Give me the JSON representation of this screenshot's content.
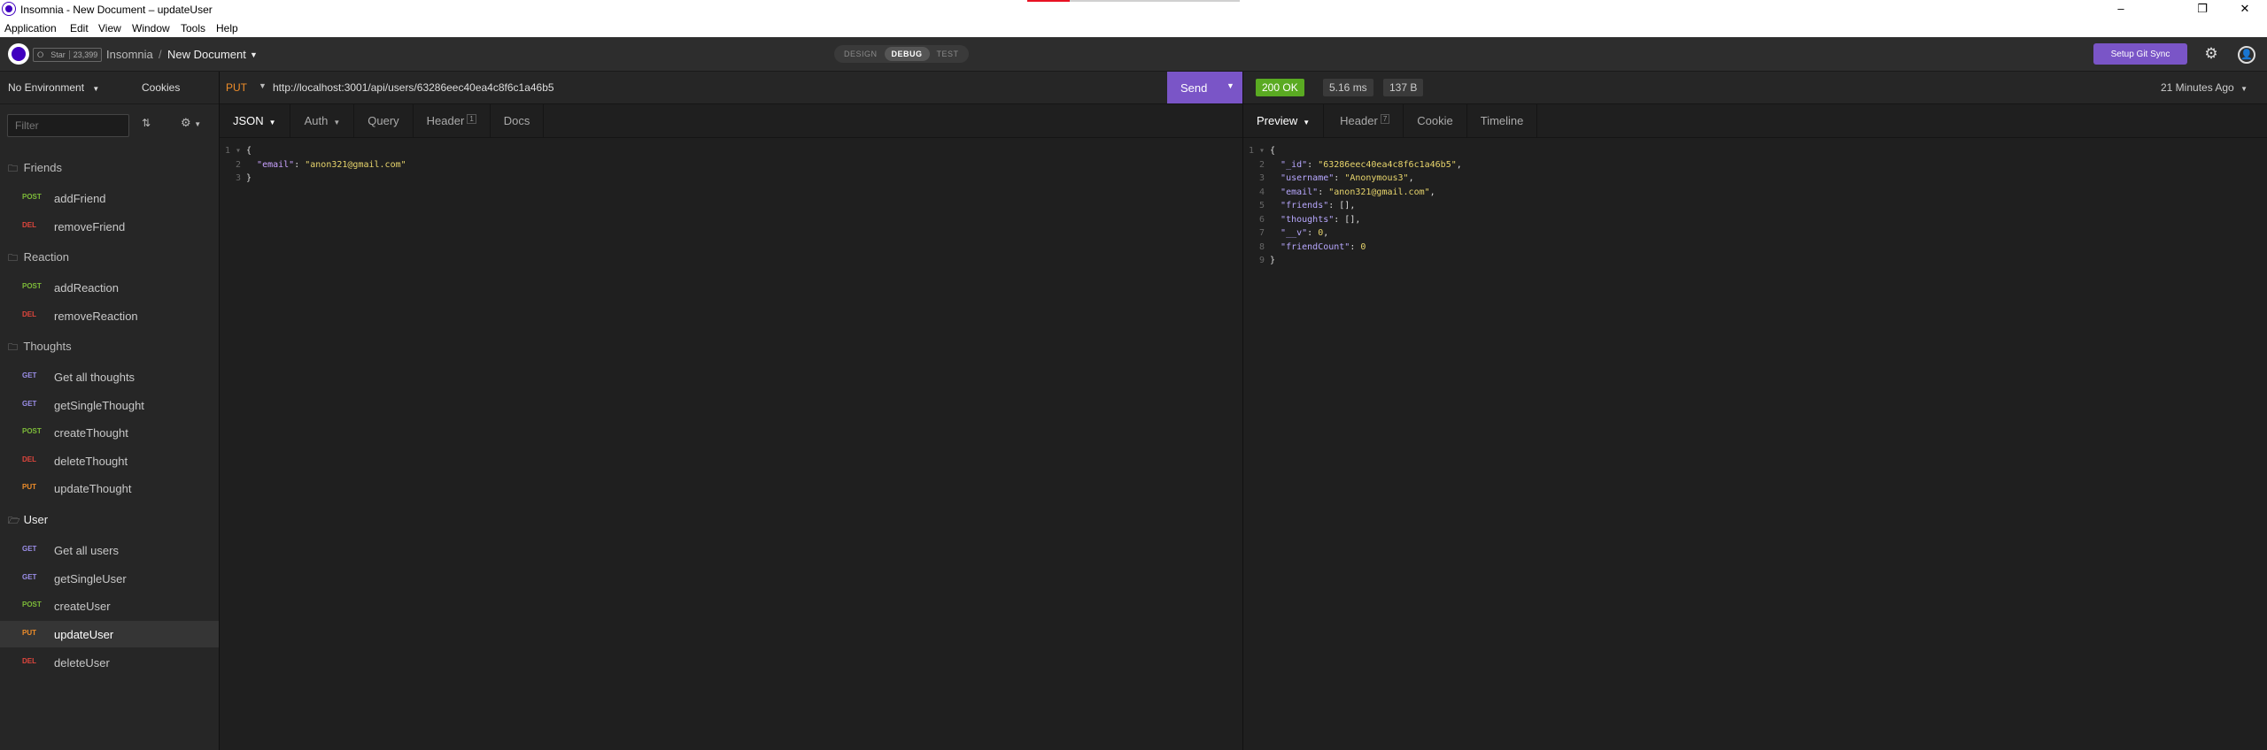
{
  "window": {
    "title": "Insomnia - New Document – updateUser",
    "minimize": "–",
    "restore": "❐",
    "close": "✕"
  },
  "menu": [
    "Application",
    "Edit",
    "View",
    "Window",
    "Tools",
    "Help"
  ],
  "header": {
    "star_label": "Star",
    "star_count": "23,399",
    "breadcrumb_root": "Insomnia",
    "breadcrumb_sep": "/",
    "document_name": "New Document",
    "modes": [
      "DESIGN",
      "DEBUG",
      "TEST"
    ],
    "active_mode": "DEBUG",
    "git_sync": "Setup Git Sync"
  },
  "sidebar": {
    "environment": "No Environment",
    "cookies": "Cookies",
    "filter_placeholder": "Filter",
    "folders": [
      {
        "name": "Friends",
        "requests": [
          {
            "method": "POST",
            "name": "addFriend"
          },
          {
            "method": "DEL",
            "name": "removeFriend"
          }
        ]
      },
      {
        "name": "Reaction",
        "requests": [
          {
            "method": "POST",
            "name": "addReaction"
          },
          {
            "method": "DEL",
            "name": "removeReaction"
          }
        ]
      },
      {
        "name": "Thoughts",
        "requests": [
          {
            "method": "GET",
            "name": "Get all thoughts"
          },
          {
            "method": "GET",
            "name": "getSingleThought"
          },
          {
            "method": "POST",
            "name": "createThought"
          },
          {
            "method": "DEL",
            "name": "deleteThought"
          },
          {
            "method": "PUT",
            "name": "updateThought"
          }
        ]
      },
      {
        "name": "User",
        "requests": [
          {
            "method": "GET",
            "name": "Get all users"
          },
          {
            "method": "GET",
            "name": "getSingleUser"
          },
          {
            "method": "POST",
            "name": "createUser"
          },
          {
            "method": "PUT",
            "name": "updateUser"
          },
          {
            "method": "DEL",
            "name": "deleteUser"
          }
        ]
      }
    ],
    "active_request": "updateUser"
  },
  "request": {
    "method": "PUT",
    "url": "http://localhost:3001/api/users/63286eec40ea4c8f6c1a46b5",
    "send": "Send",
    "tabs": {
      "body": "JSON",
      "auth": "Auth",
      "query": "Query",
      "header": "Header",
      "header_count": "1",
      "docs": "Docs"
    },
    "body_lines": [
      "{",
      "  \"email\": \"anon321@gmail.com\"",
      "}"
    ]
  },
  "response": {
    "status": "200 OK",
    "time": "5.16 ms",
    "size": "137 B",
    "ago": "21 Minutes Ago",
    "tabs": {
      "preview": "Preview",
      "header": "Header",
      "header_count": "7",
      "cookie": "Cookie",
      "timeline": "Timeline"
    },
    "body_lines": [
      "{",
      "  \"_id\": \"63286eec40ea4c8f6c1a46b5\",",
      "  \"username\": \"Anonymous3\",",
      "  \"email\": \"anon321@gmail.com\",",
      "  \"friends\": [],",
      "  \"thoughts\": [],",
      "  \"__v\": 0,",
      "  \"friendCount\": 0",
      "}"
    ]
  },
  "colors": {
    "accent": "#7a55c7",
    "ok": "#5aaa22",
    "post": "#7dbb39",
    "del": "#e0463d",
    "get": "#9b8ee8",
    "put": "#ee8d2a"
  }
}
